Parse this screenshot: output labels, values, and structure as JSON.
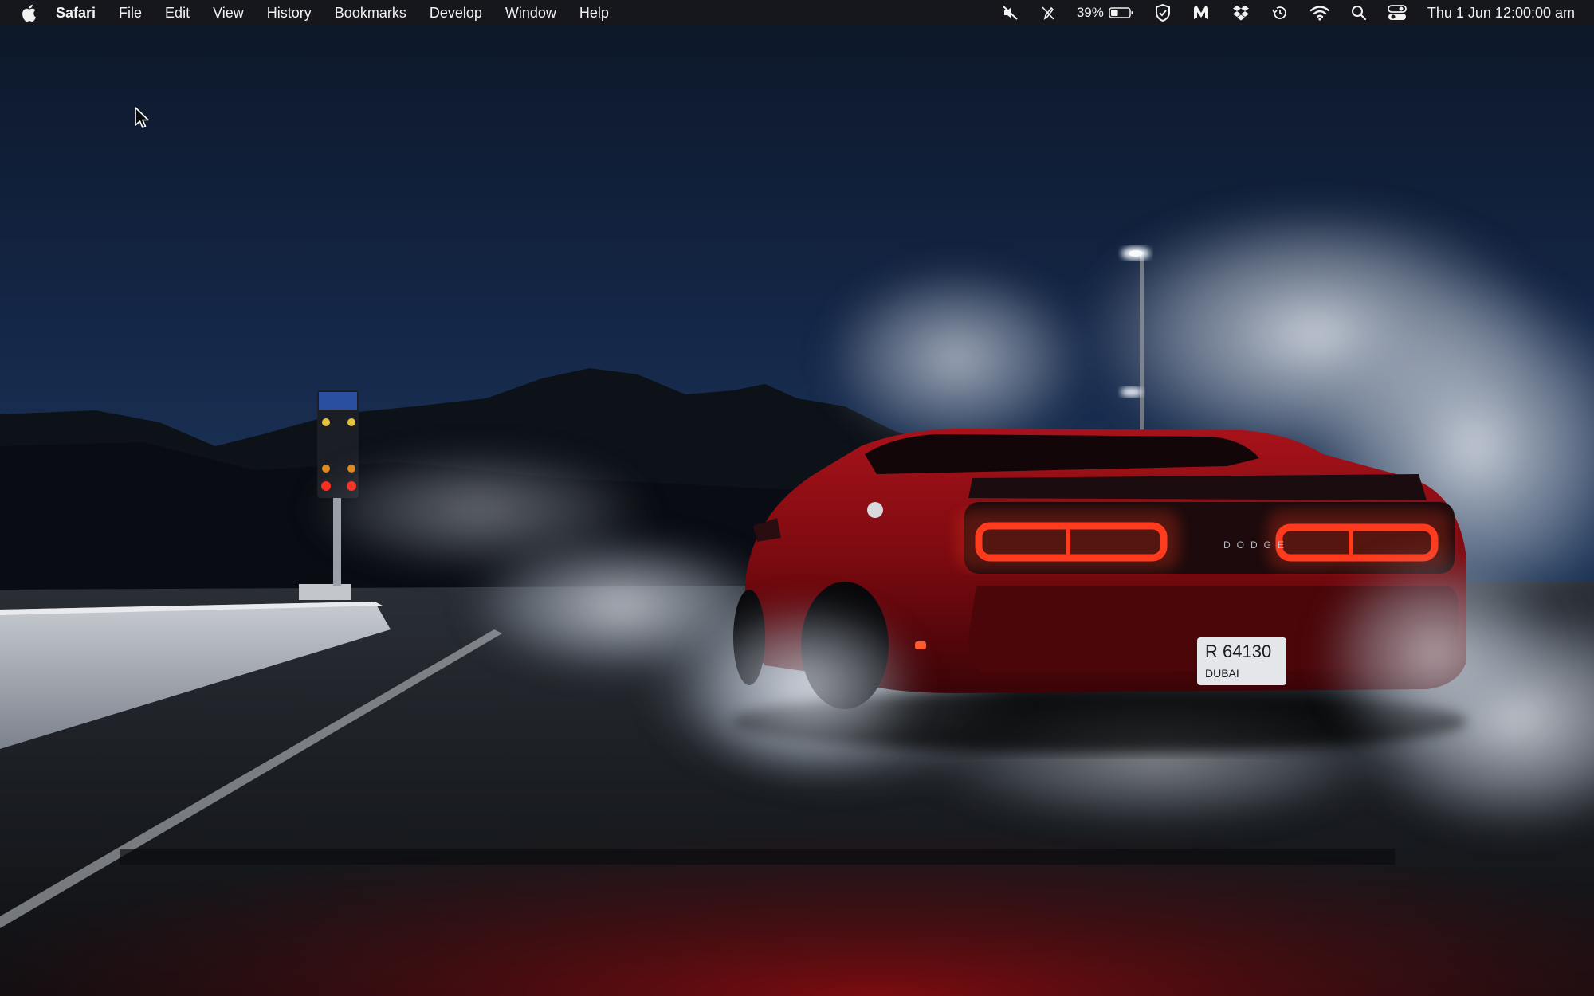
{
  "menubar": {
    "apple_icon": "apple-logo-icon",
    "app_name": "Safari",
    "menus": [
      "File",
      "Edit",
      "View",
      "History",
      "Bookmarks",
      "Develop",
      "Window",
      "Help"
    ],
    "status": {
      "mute_icon": "speaker-muted-icon",
      "pen_icon": "pen-slash-icon",
      "battery_percent": "39%",
      "battery_level": 0.39,
      "vpn_icon": "shield-check-icon",
      "malwarebytes_icon": "malwarebytes-icon",
      "dropbox_icon": "dropbox-icon",
      "time_machine_icon": "time-machine-icon",
      "wifi_icon": "wifi-icon",
      "spotlight_icon": "search-icon",
      "control_center_icon": "control-center-icon",
      "datetime": "Thu 1 Jun  12:00:00 am"
    }
  },
  "wallpaper": {
    "plate_line1": "R 64130",
    "plate_line2": "DUBAI",
    "badge": "DODGE",
    "colors": {
      "sky": "#0f1c33",
      "car": "#8e0d12",
      "taillight": "#ff3b1f",
      "smoke": "#c9ced6"
    }
  }
}
